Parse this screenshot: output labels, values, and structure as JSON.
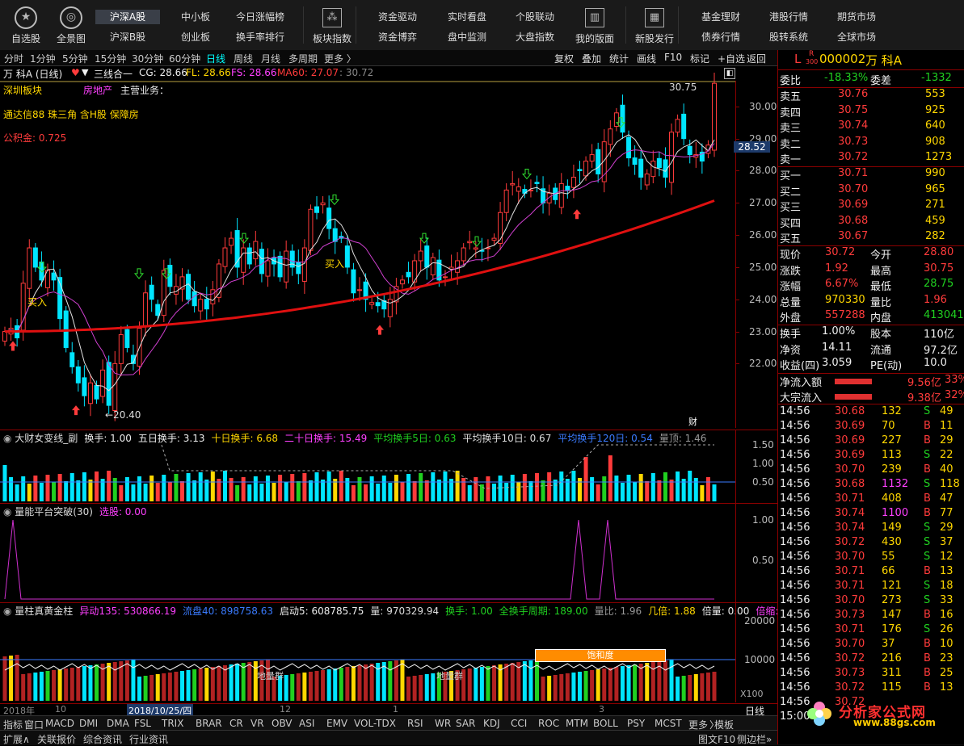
{
  "toolbar_left": [
    {
      "label": "自选股",
      "icon": "star-icon",
      "glyph": "★"
    },
    {
      "label": "全景图",
      "icon": "globe-icon",
      "glyph": "◎"
    }
  ],
  "menu_row1": [
    "沪深A股",
    "中小板",
    "今日涨幅榜",
    "",
    "资金驱动",
    "实时看盘",
    "个股联动",
    "",
    "",
    "基金理财",
    "港股行情",
    "期货市场"
  ],
  "menu_row2": [
    "沪深B股",
    "创业板",
    "换手率排行",
    "",
    "资金博弈",
    "盘中监测",
    "大盘指数",
    "",
    "",
    "债券行情",
    "股转系统",
    "全球市场"
  ],
  "toolbar_mid": [
    {
      "label": "板块指数",
      "icon": "grid-icon"
    },
    {
      "label": "我的版面",
      "icon": "layout-icon"
    },
    {
      "label": "新股发行",
      "icon": "calendar-icon"
    }
  ],
  "periods": [
    "分时",
    "1分钟",
    "5分钟",
    "15分钟",
    "30分钟",
    "60分钟",
    "日线",
    "周线",
    "月线",
    "多周期",
    "更多 〉"
  ],
  "active_period": "日线",
  "tools": [
    "复权",
    "叠加",
    "统计",
    "画线",
    "F10",
    "标记",
    "+自选",
    "返回"
  ],
  "stock": {
    "title": "万 科A (日线)",
    "formula": "三线合一",
    "cg": "CG: 28.66",
    "fl": "FL: 28.66",
    "fs": "FS: 28.66",
    "ma60": "MA60: 27.07",
    "extra": ": 30.72",
    "sector": "深圳板块",
    "industry": "房地产",
    "business": "主营业务：",
    "concepts": "通达信88 珠三角 含H股 保障房",
    "fund": "公积金: 0.725",
    "high_label": "30.75",
    "low_label": "←20.40",
    "buy_label": "买入",
    "current_price_tag": "28.52",
    "cai_label": "财"
  },
  "price_axis": [
    "30.00",
    "29.00",
    "28.00",
    "27.00",
    "26.00",
    "25.00",
    "24.00",
    "23.00",
    "22.00"
  ],
  "panel2": {
    "name": "大财女变线_副",
    "items": [
      "换手: 1.00",
      "五日换手: 3.13",
      "十日换手: 6.68",
      "二十日换手: 15.49",
      "平均换手5日: 0.63",
      "平均换手10日: 0.67",
      "平均换手120日: 0.54",
      "量顶: 1.46"
    ],
    "axis": [
      "1.50",
      "1.00",
      "0.50"
    ]
  },
  "panel3": {
    "name": "量能平台突破(30)",
    "items": [
      "选股: 0.00"
    ],
    "axis": [
      "1.00",
      "0.50"
    ]
  },
  "panel4": {
    "name": "量柱真黄金柱",
    "items": [
      "异动135: 530866.19",
      "流盘40: 898758.63",
      "启动5: 608785.75",
      "量: 970329.94",
      "换手: 1.00",
      "全换手周期: 189.00",
      "量比: 1.96",
      "几倍: 1.88",
      "倍量: 0.00",
      "倍缩: 0.0"
    ],
    "axis": [
      "20000",
      "10000"
    ],
    "unit": "X100",
    "tag_saturation": "饱和度",
    "tag_ground1": "地量群",
    "tag_ground2": "地量群"
  },
  "date_axis": {
    "year": "2018年",
    "m10": "10",
    "cursor": "2018/10/25/四",
    "m12": "12",
    "m1": "1",
    "m3": "3",
    "period": "日线"
  },
  "indicators": [
    "指标",
    "窗口",
    "MACD",
    "DMI",
    "DMA",
    "FSL",
    "TRIX",
    "BRAR",
    "CR",
    "VR",
    "OBV",
    "ASI",
    "EMV",
    "VOL-TDX",
    "RSI",
    "WR",
    "SAR",
    "KDJ",
    "CCI",
    "ROC",
    "MTM",
    "BOLL",
    "PSY",
    "MCST",
    "更多",
    "〉",
    "模板"
  ],
  "status": [
    "扩展∧",
    "关联报价",
    "综合资讯",
    "行业资讯"
  ],
  "status_right": [
    "图文F10",
    "侧边栏»",
    "笔",
    "价"
  ],
  "quote": {
    "code_prefix": "L",
    "r_badge": "R",
    "badge_300": "300",
    "code": "000002",
    "name": "万 科A",
    "webi_label": "委比",
    "webi": "-18.33%",
    "wecha_label": "委差",
    "wecha": "-1332",
    "asks": [
      [
        "卖五",
        "30.76",
        "553"
      ],
      [
        "卖四",
        "30.75",
        "925"
      ],
      [
        "卖三",
        "30.74",
        "640"
      ],
      [
        "卖二",
        "30.73",
        "908"
      ],
      [
        "卖一",
        "30.72",
        "1273"
      ]
    ],
    "bids": [
      [
        "买一",
        "30.71",
        "990"
      ],
      [
        "买二",
        "30.70",
        "965"
      ],
      [
        "买三",
        "30.69",
        "271"
      ],
      [
        "买四",
        "30.68",
        "459"
      ],
      [
        "买五",
        "30.67",
        "282"
      ]
    ],
    "stats": [
      [
        "现价",
        "30.72",
        "今开",
        "28.80"
      ],
      [
        "涨跌",
        "1.92",
        "最高",
        "30.75"
      ],
      [
        "涨幅",
        "6.67%",
        "最低",
        "28.75"
      ],
      [
        "总量",
        "970330",
        "量比",
        "1.96"
      ],
      [
        "外盘",
        "557288",
        "内盘",
        "413041"
      ]
    ],
    "fund_stats": [
      [
        "换手",
        "1.00%",
        "股本",
        "110亿"
      ],
      [
        "净资",
        "14.11",
        "流通",
        "97.2亿"
      ],
      [
        "收益(四)",
        "3.059",
        "PE(动)",
        "10.0"
      ]
    ],
    "netin_label": "净流入额",
    "netin": "9.56亿",
    "netin_pct": "33%",
    "bulk_label": "大宗流入",
    "bulk": "9.38亿",
    "bulk_pct": "32%",
    "ticks": [
      [
        "14:56",
        "30.68",
        "132",
        "S",
        "49"
      ],
      [
        "14:56",
        "30.69",
        "70",
        "B",
        "11"
      ],
      [
        "14:56",
        "30.69",
        "227",
        "B",
        "29"
      ],
      [
        "14:56",
        "30.69",
        "113",
        "S",
        "22"
      ],
      [
        "14:56",
        "30.70",
        "239",
        "B",
        "40"
      ],
      [
        "14:56",
        "30.68",
        "1132",
        "S",
        "118"
      ],
      [
        "14:56",
        "30.71",
        "408",
        "B",
        "47"
      ],
      [
        "14:56",
        "30.74",
        "1100",
        "B",
        "77"
      ],
      [
        "14:56",
        "30.74",
        "149",
        "S",
        "29"
      ],
      [
        "14:56",
        "30.72",
        "430",
        "S",
        "37"
      ],
      [
        "14:56",
        "30.70",
        "55",
        "S",
        "12"
      ],
      [
        "14:56",
        "30.71",
        "66",
        "B",
        "13"
      ],
      [
        "14:56",
        "30.71",
        "121",
        "S",
        "18"
      ],
      [
        "14:56",
        "30.70",
        "273",
        "S",
        "33"
      ],
      [
        "14:56",
        "30.73",
        "147",
        "B",
        "16"
      ],
      [
        "14:56",
        "30.71",
        "176",
        "S",
        "26"
      ],
      [
        "14:56",
        "30.70",
        "37",
        "B",
        "10"
      ],
      [
        "14:56",
        "30.72",
        "216",
        "B",
        "23"
      ],
      [
        "14:56",
        "30.73",
        "311",
        "B",
        "25"
      ],
      [
        "14:56",
        "30.72",
        "115",
        "B",
        "13"
      ],
      [
        "14:56",
        "30.72",
        "",
        "",
        ""
      ],
      [
        "15:00",
        "",
        "",
        "",
        ""
      ]
    ]
  },
  "watermark": {
    "title": "分析家公式网",
    "url": "www.88gs.com"
  },
  "chart_data": {
    "type": "candlestick",
    "symbol": "000002",
    "period": "日线",
    "ylim": [
      20.0,
      30.8
    ],
    "ma60_last": 27.07,
    "high": 30.75,
    "low": 20.4,
    "last_close": 30.72,
    "closes": [
      23.0,
      23.1,
      22.8,
      24.5,
      25.6,
      25.0,
      24.6,
      24.9,
      24.6,
      23.4,
      22.5,
      21.9,
      21.4,
      21.0,
      21.4,
      20.9,
      21.8,
      20.7,
      22.0,
      22.9,
      22.5,
      22.0,
      23.1,
      24.2,
      24.0,
      23.5,
      24.9,
      24.4,
      24.4,
      24.7,
      24.0,
      23.8,
      24.0,
      23.7,
      24.3,
      25.1,
      25.6,
      25.9,
      25.0,
      25.6,
      25.1,
      25.8,
      24.8,
      25.2,
      25.1,
      24.7,
      25.5,
      25.0,
      24.8,
      25.6,
      26.8,
      26.7,
      27.0,
      26.2,
      25.8,
      25.9,
      25.0,
      24.2,
      24.3,
      24.0,
      23.9,
      23.8,
      23.7,
      24.0,
      24.4,
      24.6,
      24.7,
      25.2,
      25.5,
      25.0,
      25.3,
      24.6,
      24.7,
      25.0,
      25.2,
      25.6,
      25.8,
      25.6,
      25.5,
      25.6,
      25.9,
      26.7,
      27.4,
      27.6,
      27.5,
      27.3,
      27.4,
      27.6,
      27.0,
      27.3,
      27.1,
      27.6,
      27.4,
      27.8,
      28.0,
      28.3,
      28.5,
      27.9,
      28.9,
      29.3,
      29.8,
      29.2,
      28.4,
      28.2,
      27.8,
      27.9,
      28.3,
      28.1,
      27.8,
      29.2,
      29.6,
      29.0,
      28.5,
      28.5,
      28.3,
      28.8,
      30.72
    ]
  }
}
